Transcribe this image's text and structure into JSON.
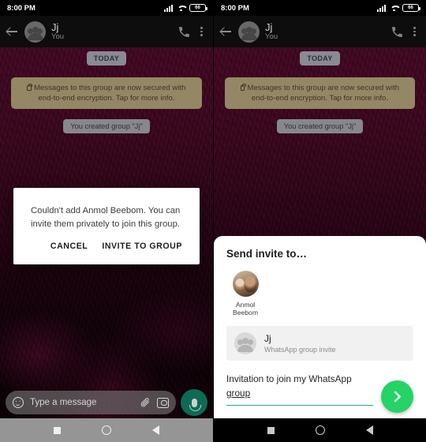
{
  "status_bar": {
    "time": "8:00 PM",
    "battery_level": "66",
    "icons": [
      "signal-icon",
      "wifi-icon",
      "battery-icon"
    ]
  },
  "app_bar": {
    "title": "Jj",
    "subtitle": "You",
    "back_icon": "back-arrow-icon",
    "call_icon": "phone-call-icon",
    "menu_icon": "overflow-menu-icon",
    "avatar": "group-avatar"
  },
  "chat": {
    "date_chip": "TODAY",
    "encryption_notice": "Messages to this group are now secured with end-to-end encryption. Tap for more info.",
    "system_message": "You created group \"Jj\""
  },
  "input_bar": {
    "placeholder": "Type a message",
    "emoji_icon": "smiley-icon",
    "attach_icon": "paperclip-icon",
    "camera_icon": "camera-icon",
    "mic_icon": "microphone-icon"
  },
  "dialog": {
    "message": "Couldn't add Anmol Beebom. You can invite them privately to join this group.",
    "cancel_label": "CANCEL",
    "invite_label": "INVITE TO GROUP"
  },
  "invite_sheet": {
    "title": "Send invite to…",
    "contact": {
      "name_line1": "Anmol",
      "name_line2": "Beebom",
      "avatar": "contact-photo-avatar"
    },
    "group_row": {
      "title": "Jj",
      "subtitle": "WhatsApp group invite",
      "avatar": "group-avatar"
    },
    "message_value_prefix": "Invitation to join my WhatsApp ",
    "message_value_underlined": "group",
    "send_icon": "send-arrow-icon"
  },
  "nav_bar": {
    "recents_icon": "square-recents-icon",
    "home_icon": "circle-home-icon",
    "back_icon": "triangle-back-icon"
  },
  "colors": {
    "whatsapp_green": "#25D366",
    "field_underline": "#1FA98A",
    "mic_fab": "#0B6B55"
  }
}
